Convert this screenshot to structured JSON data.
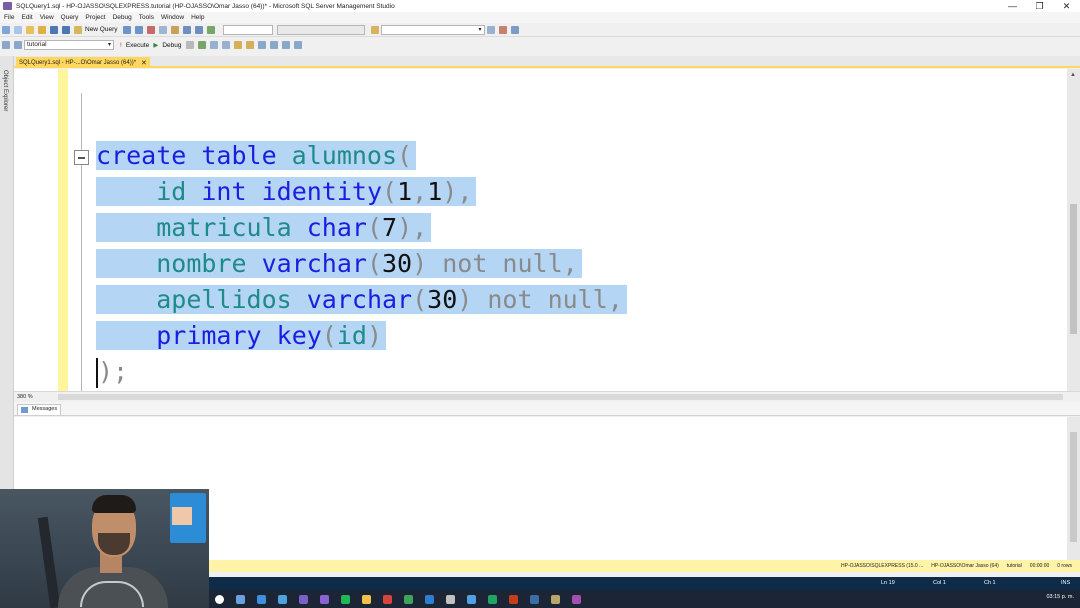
{
  "window": {
    "title": "SQLQuery1.sql - HP-OJASSO\\SQLEXPRESS.tutorial (HP-OJASSO\\Omar Jasso (64))* - Microsoft SQL Server Management Studio",
    "controls": [
      "—",
      "❐",
      "✕"
    ]
  },
  "menu": [
    "File",
    "Edit",
    "View",
    "Query",
    "Project",
    "Debug",
    "Tools",
    "Window",
    "Help"
  ],
  "toolbar1": {
    "new_query": "New Query"
  },
  "toolbar2": {
    "database": "tutorial",
    "execute": "Execute",
    "debug": "Debug"
  },
  "document_tab": {
    "label": "SQLQuery1.sql - HP-...O\\Omar Jasso (64))*",
    "close": "✕"
  },
  "side_panel": {
    "label": "Object Explorer"
  },
  "editor": {
    "zoom": "380 %",
    "lines": [
      [
        {
          "t": "create ",
          "c": "kw"
        },
        {
          "t": "table ",
          "c": "kw"
        },
        {
          "t": "alumnos",
          "c": "id"
        },
        {
          "t": "(",
          "c": "pun"
        }
      ],
      [
        {
          "t": "    "
        },
        {
          "t": "id ",
          "c": "id"
        },
        {
          "t": "int ",
          "c": "kw"
        },
        {
          "t": "identity",
          "c": "kw"
        },
        {
          "t": "(",
          "c": "pun"
        },
        {
          "t": "1",
          "c": "num"
        },
        {
          "t": ",",
          "c": "pun"
        },
        {
          "t": "1",
          "c": "num"
        },
        {
          "t": "),",
          "c": "pun"
        }
      ],
      [
        {
          "t": "    "
        },
        {
          "t": "matricula ",
          "c": "id"
        },
        {
          "t": "char",
          "c": "kw"
        },
        {
          "t": "(",
          "c": "pun"
        },
        {
          "t": "7",
          "c": "num"
        },
        {
          "t": "),",
          "c": "pun"
        }
      ],
      [
        {
          "t": "    "
        },
        {
          "t": "nombre ",
          "c": "id"
        },
        {
          "t": "varchar",
          "c": "kw"
        },
        {
          "t": "(",
          "c": "pun"
        },
        {
          "t": "30",
          "c": "num"
        },
        {
          "t": ") not null,",
          "c": "pun"
        }
      ],
      [
        {
          "t": "    "
        },
        {
          "t": "apellidos ",
          "c": "id"
        },
        {
          "t": "varchar",
          "c": "kw"
        },
        {
          "t": "(",
          "c": "pun"
        },
        {
          "t": "30",
          "c": "num"
        },
        {
          "t": ") not null,",
          "c": "pun"
        }
      ],
      [
        {
          "t": "    "
        },
        {
          "t": "primary ",
          "c": "kw"
        },
        {
          "t": "key",
          "c": "kw"
        },
        {
          "t": "(",
          "c": "pun"
        },
        {
          "t": "id",
          "c": "id"
        },
        {
          "t": ")",
          "c": "pun"
        }
      ]
    ],
    "last_line": ");"
  },
  "results": {
    "tab": "Messages"
  },
  "status": {
    "server": "HP-OJASSO\\SQLEXPRESS (15.0 ...",
    "user": "HP-OJASSO\\Omar Jasso (64)",
    "database": "tutorial",
    "time": "00:00:00",
    "rows": "0 rows"
  },
  "app_status": {
    "ln": "Ln 19",
    "col": "Col 1",
    "ch": "Ch 1",
    "ins": "INS"
  },
  "taskbar": {
    "clock": "03:15 p. m."
  },
  "colors": {
    "keyword": "#1d1de0",
    "identifier": "#1f8a8a",
    "selection": "#b4d5f4",
    "status_bar": "#fff3a8",
    "tab": "#ffd75e"
  }
}
